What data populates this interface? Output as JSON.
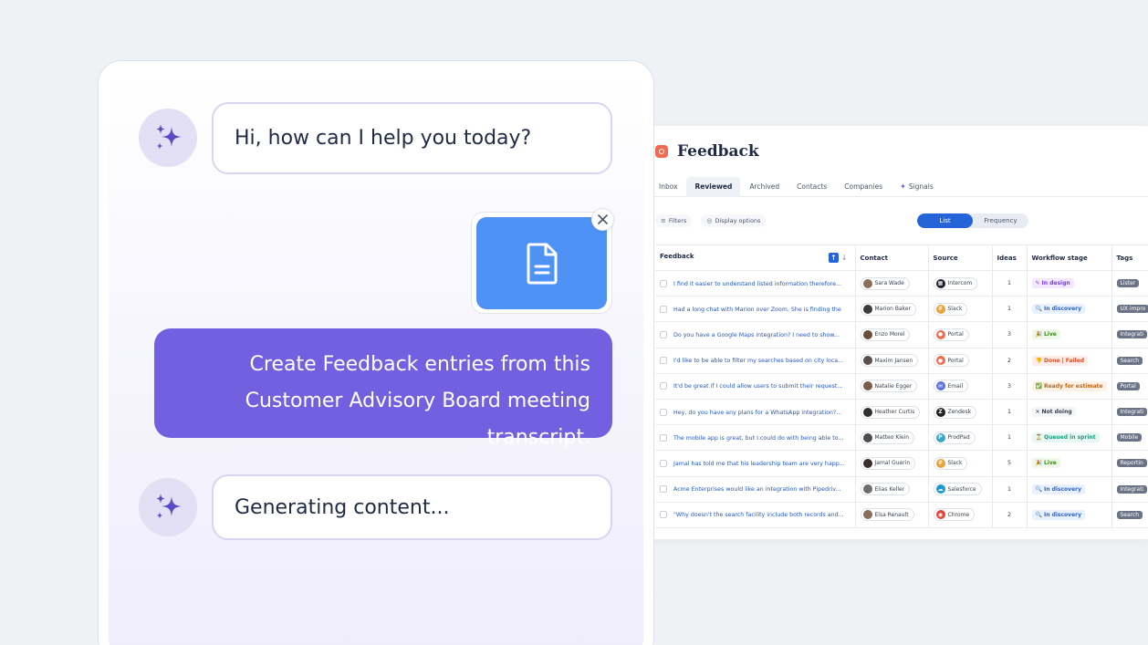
{
  "chat": {
    "greeting": "Hi, how can I help you today?",
    "user_message": "Create Feedback entries from this Customer Advisory Board meeting transcript.",
    "status": "Generating content..."
  },
  "feedback": {
    "title": "Feedback",
    "tabs": [
      "Inbox",
      "Reviewed",
      "Archived",
      "Contacts",
      "Companies",
      "Signals"
    ],
    "active_tab": "Reviewed",
    "filters_label": "Filters",
    "display_options_label": "Display options",
    "view_toggle": [
      "List",
      "Frequency"
    ],
    "columns": [
      "Feedback",
      "Contact",
      "Source",
      "Ideas",
      "Workflow stage",
      "Tags"
    ],
    "rows": [
      {
        "text": "I find it easier to understand listed information therefore...",
        "contact": "Sara Wade",
        "source": "Intercom",
        "ideas": "1",
        "stage": "In design",
        "tag": "Lister"
      },
      {
        "text": "Had a long chat with Marion over Zoom. She is finding the",
        "contact": "Marion Baker",
        "source": "Slack",
        "ideas": "1",
        "stage": "In discovery",
        "tag": "UX impro"
      },
      {
        "text": "Do you have a Google Maps integration? I need to show...",
        "contact": "Enzo Morel",
        "source": "Portal",
        "ideas": "3",
        "stage": "Live",
        "tag": "Integrati"
      },
      {
        "text": "I'd like to be able to filter my searches based on city loca...",
        "contact": "Maxim Jansen",
        "source": "Portal",
        "ideas": "2",
        "stage": "Done | Failed",
        "tag": "Search"
      },
      {
        "text": "It'd be great if I could allow users to submit their request...",
        "contact": "Natalie Egger",
        "source": "Email",
        "ideas": "3",
        "stage": "Ready for estimate",
        "tag": "Portal"
      },
      {
        "text": "Hey, do you have any plans for a WhatsApp integration?...",
        "contact": "Heather Curtis",
        "source": "Zendesk",
        "ideas": "1",
        "stage": "Not doing",
        "tag": "Integrati"
      },
      {
        "text": "The mobile app is great, but I could do with being able to...",
        "contact": "Matteo Klein",
        "source": "ProdPad",
        "ideas": "1",
        "stage": "Queued in sprint",
        "tag": "Mobile"
      },
      {
        "text": "Jamal has told me that his leadership team are very happ...",
        "contact": "Jamal Guerin",
        "source": "Slack",
        "ideas": "5",
        "stage": "Live",
        "tag": "Reportin"
      },
      {
        "text": "Acme Enterprises would like an integration with Pipedriv...",
        "contact": "Elias Keller",
        "source": "Salesforce",
        "ideas": "1",
        "stage": "In discovery",
        "tag": "Integrati"
      },
      {
        "text": "\"Why doesn't the search facility include both records and...",
        "contact": "Elsa Renault",
        "source": "Chrome",
        "ideas": "2",
        "stage": "In discovery",
        "tag": "Search"
      }
    ]
  },
  "colors": {
    "accent_purple": "#7360e0",
    "file_blue": "#4f92f5",
    "primary_blue": "#2563d8",
    "brand_orange": "#f06b4f"
  }
}
